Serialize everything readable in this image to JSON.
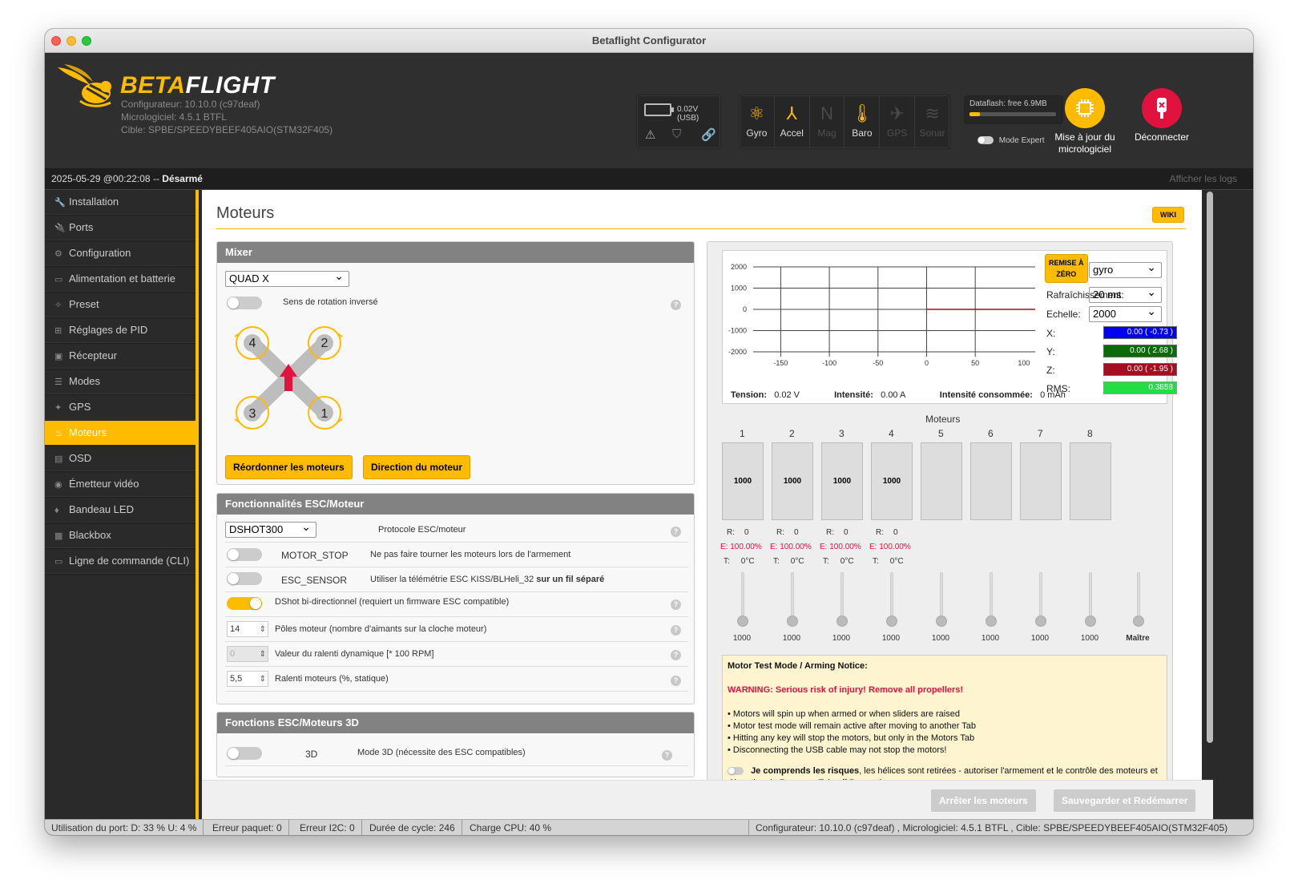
{
  "window": {
    "title": "Betaflight Configurator"
  },
  "brand": {
    "name_part1": "BETA",
    "name_part2": "FLIGHT",
    "configurator": "Configurateur: 10.10.0 (c97deaf)",
    "firmware": "Micrologiciel: 4.5.1 BTFL",
    "target": "Cible: SPBE/SPEEDYBEEF405AIO(STM32F405)"
  },
  "power": {
    "voltage": "0.02V (USB)"
  },
  "sensors": [
    {
      "label": "Gyro",
      "icon": "gyro-icon",
      "active": true
    },
    {
      "label": "Accel",
      "icon": "accel-icon",
      "active": true
    },
    {
      "label": "Mag",
      "icon": "mag-icon",
      "active": false
    },
    {
      "label": "Baro",
      "icon": "baro-icon",
      "active": true
    },
    {
      "label": "GPS",
      "icon": "gps-icon",
      "active": false
    },
    {
      "label": "Sonar",
      "icon": "sonar-icon",
      "active": false
    }
  ],
  "dataflash": {
    "label": "Dataflash: free 6.9MB",
    "used_fraction": 0.12
  },
  "expert_mode": {
    "label": "Mode Expert",
    "enabled": false
  },
  "firmware_update": {
    "label_line1": "Mise à jour du",
    "label_line2": "micrologiciel"
  },
  "disconnect": {
    "label": "Déconnecter"
  },
  "status": {
    "datetime": "2025-05-29 @00:22:08 -- ",
    "state": "Désarmé",
    "show_logs": "Afficher les logs"
  },
  "sidebar": {
    "items": [
      {
        "label": "Installation",
        "icon": "wrench-icon",
        "glyph": "🔧"
      },
      {
        "label": "Ports",
        "icon": "plug-icon",
        "glyph": "🔌"
      },
      {
        "label": "Configuration",
        "icon": "gear-icon",
        "glyph": "⚙"
      },
      {
        "label": "Alimentation et batterie",
        "icon": "battery-icon",
        "glyph": "▭"
      },
      {
        "label": "Preset",
        "icon": "wand-icon",
        "glyph": "✧"
      },
      {
        "label": "Réglages de PID",
        "icon": "sitemap-icon",
        "glyph": "⊞"
      },
      {
        "label": "Récepteur",
        "icon": "receiver-icon",
        "glyph": "▣"
      },
      {
        "label": "Modes",
        "icon": "toggles-icon",
        "glyph": "☰"
      },
      {
        "label": "GPS",
        "icon": "satellite-icon",
        "glyph": "✦"
      },
      {
        "label": "Moteurs",
        "icon": "motor-icon",
        "glyph": "♨",
        "active": true
      },
      {
        "label": "OSD",
        "icon": "osd-icon",
        "glyph": "▤"
      },
      {
        "label": "Émetteur vidéo",
        "icon": "broadcast-icon",
        "glyph": "◉"
      },
      {
        "label": "Bandeau LED",
        "icon": "led-icon",
        "glyph": "♦"
      },
      {
        "label": "Blackbox",
        "icon": "blackbox-icon",
        "glyph": "▦"
      },
      {
        "label": "Ligne de commande (CLI)",
        "icon": "terminal-icon",
        "glyph": "▭"
      }
    ]
  },
  "page": {
    "title": "Moteurs",
    "wiki": "WIKI"
  },
  "mixer": {
    "title": "Mixer",
    "selected": "QUAD X",
    "reverse_label": "Sens de rotation inversé",
    "motor_numbers": [
      "4",
      "2",
      "3",
      "1"
    ],
    "reorder_button": "Réordonner les moteurs",
    "direction_button": "Direction du moteur"
  },
  "esc": {
    "title": "Fonctionnalités ESC/Moteur",
    "protocol_value": "DSHOT300",
    "protocol_label": "Protocole ESC/moteur",
    "motor_stop_name": "MOTOR_STOP",
    "motor_stop_desc": "Ne pas faire tourner les moteurs lors de l'armement",
    "esc_sensor_name": "ESC_SENSOR",
    "esc_sensor_desc": "Utiliser la télémétrie ESC KISS/BLHeli_32 ",
    "esc_sensor_bold": "sur un fil séparé",
    "dshot_bidir_desc": "DShot bi-directionnel (requiert un firmware ESC compatible)",
    "poles_value": "14",
    "poles_label": "Pôles moteur (nombre d'aimants sur la cloche moteur)",
    "dyn_idle_value": "0",
    "dyn_idle_label": "Valeur du ralenti dynamique [* 100 RPM]",
    "idle_value": "5,5",
    "idle_label": "Ralenti moteurs (%, statique)"
  },
  "esc3d": {
    "title": "Fonctions ESC/Moteurs 3D",
    "name": "3D",
    "desc": "Mode 3D (nécessite des ESC compatibles)"
  },
  "graph": {
    "reset_line1": "REMISE À",
    "reset_line2": "ZÉRO",
    "source": "gyro",
    "refresh_label": "Rafraîchissement:",
    "refresh_value": "20 ms",
    "scale_label": "Echelle:",
    "scale_value": "2000",
    "x_label": "X:",
    "x_value": "0.00 ( -0.73 )",
    "y_label": "Y:",
    "y_value": "0.00 ( 2.68 )",
    "z_label": "Z:",
    "z_value": "0.00 ( -1.95 )",
    "rms_label": "RMS:",
    "rms_value": "0.3858",
    "y_ticks": [
      "2000",
      "1000",
      "0",
      "-1000",
      "-2000"
    ],
    "x_ticks": [
      "-150",
      "-100",
      "-50",
      "0",
      "50",
      "100"
    ],
    "tension_label": "Tension:",
    "tension_value": "0.02 V",
    "current_label": "Intensité:",
    "current_value": "0.00 A",
    "consumed_label": "Intensité consommée:",
    "consumed_value": "0 mAh",
    "colors": {
      "x": "#0000ee",
      "y": "#0b6b0b",
      "z": "#a30f1e",
      "rms": "#22dd44"
    }
  },
  "motors": {
    "title": "Moteurs",
    "numbers": [
      "1",
      "2",
      "3",
      "4",
      "5",
      "6",
      "7",
      "8"
    ],
    "values": [
      "1000",
      "1000",
      "1000",
      "1000",
      "",
      "",
      "",
      ""
    ],
    "rpm_label": "R:",
    "rpm_value": "0",
    "err_label": "E: 100.00%",
    "temp_label": "T:",
    "temp_value": "0°C",
    "slider_values": [
      "1000",
      "1000",
      "1000",
      "1000",
      "1000",
      "1000",
      "1000",
      "1000"
    ],
    "master_label": "Maître"
  },
  "notice": {
    "title": "Motor Test Mode / Arming Notice:",
    "warning": "WARNING: Serious risk of injury! Remove all propellers!",
    "lines": [
      "• Motors will spin up when armed or when sliders are raised",
      "• Motor test mode will remain active after moving to another Tab",
      "• Hitting any key will stop the motors, but only in the Motors Tab",
      "• Disconnecting the USB cable may not stop the motors!"
    ],
    "ack_bold": "Je comprends les risques",
    "ack_rest": ", les hélices sont retirées - autoriser l'armement et le contrôle des moteurs et désactiver le Runaway Takeoff Prevention"
  },
  "footer": {
    "stop_motors": "Arrêter les moteurs",
    "save_reboot": "Sauvegarder et Redémarrer"
  },
  "bottombar": {
    "port_usage": "Utilisation du port: D: 33 % U: 4 %",
    "packet_error": "Erreur paquet: 0",
    "i2c_error": "Erreur I2C: 0",
    "cycle_time": "Durée de cycle: 246",
    "cpu_load": "Charge CPU: 40 %",
    "version_info": "Configurateur: 10.10.0 (c97deaf) , Micrologiciel: 4.5.1 BTFL , Cible: SPBE/SPEEDYBEEF405AIO(STM32F405)"
  }
}
